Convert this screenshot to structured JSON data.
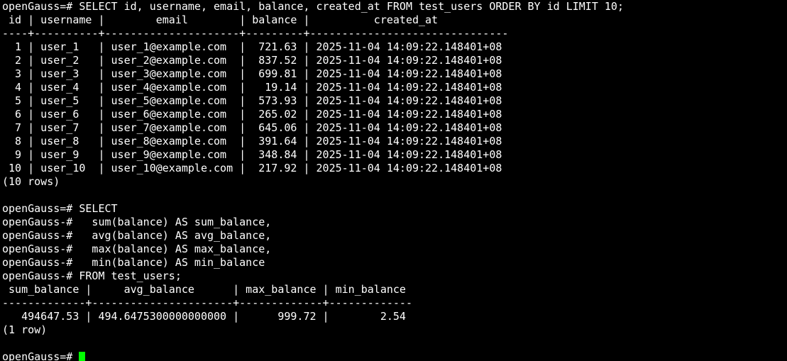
{
  "terminal": {
    "lines": [
      "openGauss=# SELECT id, username, email, balance, created_at FROM test_users ORDER BY id LIMIT 10;",
      " id | username |        email        | balance |          created_at",
      "----+----------+---------------------+---------+-------------------------------",
      "  1 | user_1   | user_1@example.com  |  721.63 | 2025-11-04 14:09:22.148401+08",
      "  2 | user_2   | user_2@example.com  |  837.52 | 2025-11-04 14:09:22.148401+08",
      "  3 | user_3   | user_3@example.com  |  699.81 | 2025-11-04 14:09:22.148401+08",
      "  4 | user_4   | user_4@example.com  |   19.14 | 2025-11-04 14:09:22.148401+08",
      "  5 | user_5   | user_5@example.com  |  573.93 | 2025-11-04 14:09:22.148401+08",
      "  6 | user_6   | user_6@example.com  |  265.02 | 2025-11-04 14:09:22.148401+08",
      "  7 | user_7   | user_7@example.com  |  645.06 | 2025-11-04 14:09:22.148401+08",
      "  8 | user_8   | user_8@example.com  |  391.64 | 2025-11-04 14:09:22.148401+08",
      "  9 | user_9   | user_9@example.com  |  348.84 | 2025-11-04 14:09:22.148401+08",
      " 10 | user_10  | user_10@example.com |  217.92 | 2025-11-04 14:09:22.148401+08",
      "(10 rows)",
      "",
      "openGauss=# SELECT",
      "openGauss-#   sum(balance) AS sum_balance,",
      "openGauss-#   avg(balance) AS avg_balance,",
      "openGauss-#   max(balance) AS max_balance,",
      "openGauss-#   min(balance) AS min_balance",
      "openGauss-# FROM test_users;",
      " sum_balance |     avg_balance      | max_balance | min_balance",
      "-------------+----------------------+-------------+-------------",
      "   494647.53 | 494.6475300000000000 |      999.72 |        2.54",
      "(1 row)",
      ""
    ],
    "prompt": "openGauss=# ",
    "cursor_color": "#00ff00",
    "text_color": "#ffffff",
    "background_color": "#000000"
  }
}
